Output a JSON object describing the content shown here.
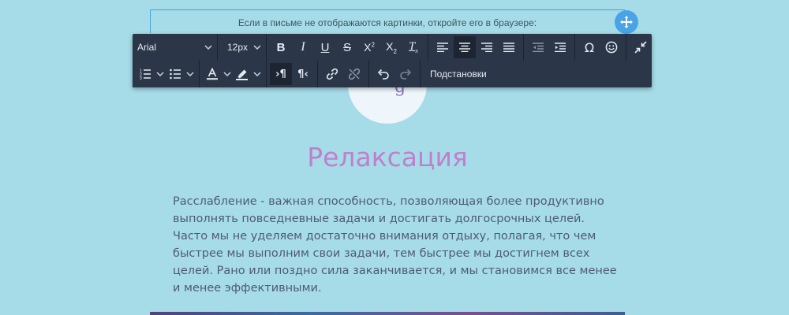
{
  "preheader": {
    "text": "Если в письме не отображаются картинки, откройте его в браузере:"
  },
  "logo": {
    "glyph": "ɡ"
  },
  "toolbar": {
    "font_family": "Arial",
    "font_size": "12px",
    "substitutions_label": "Подстановки",
    "buttons_row1": [
      "bold",
      "italic",
      "underline",
      "strikethrough",
      "superscript",
      "subscript",
      "clear-format",
      "align-left",
      "align-center",
      "align-right",
      "align-justify",
      "outdent",
      "indent",
      "special-characters",
      "emoji",
      "collapse"
    ],
    "buttons_row2": [
      "ordered-list",
      "unordered-list",
      "text-color",
      "highlight-color",
      "ltr",
      "rtl",
      "link",
      "unlink",
      "undo",
      "redo"
    ],
    "active_alignment": "center",
    "accent_color": "#4aa3e6",
    "background_color": "#2b3648"
  },
  "content": {
    "headline": "Релаксация",
    "paragraph_lines": [
      "Расслабление - важная способность, позволяющая более продуктивно",
      "выполнять повседневные задачи и достигать долгосрочных целей.",
      "Часто мы не уделяем достаточно внимания отдыху, полагая, что чем",
      "быстрее мы выполним свои задачи, тем быстрее мы достигнем всех",
      "целей. Рано или поздно сила заканчивается, и мы становимся все менее",
      "и менее эффективными."
    ],
    "headline_color": "#c07fcc",
    "text_color": "#4f5b73",
    "background_color": "#a6dce8"
  }
}
